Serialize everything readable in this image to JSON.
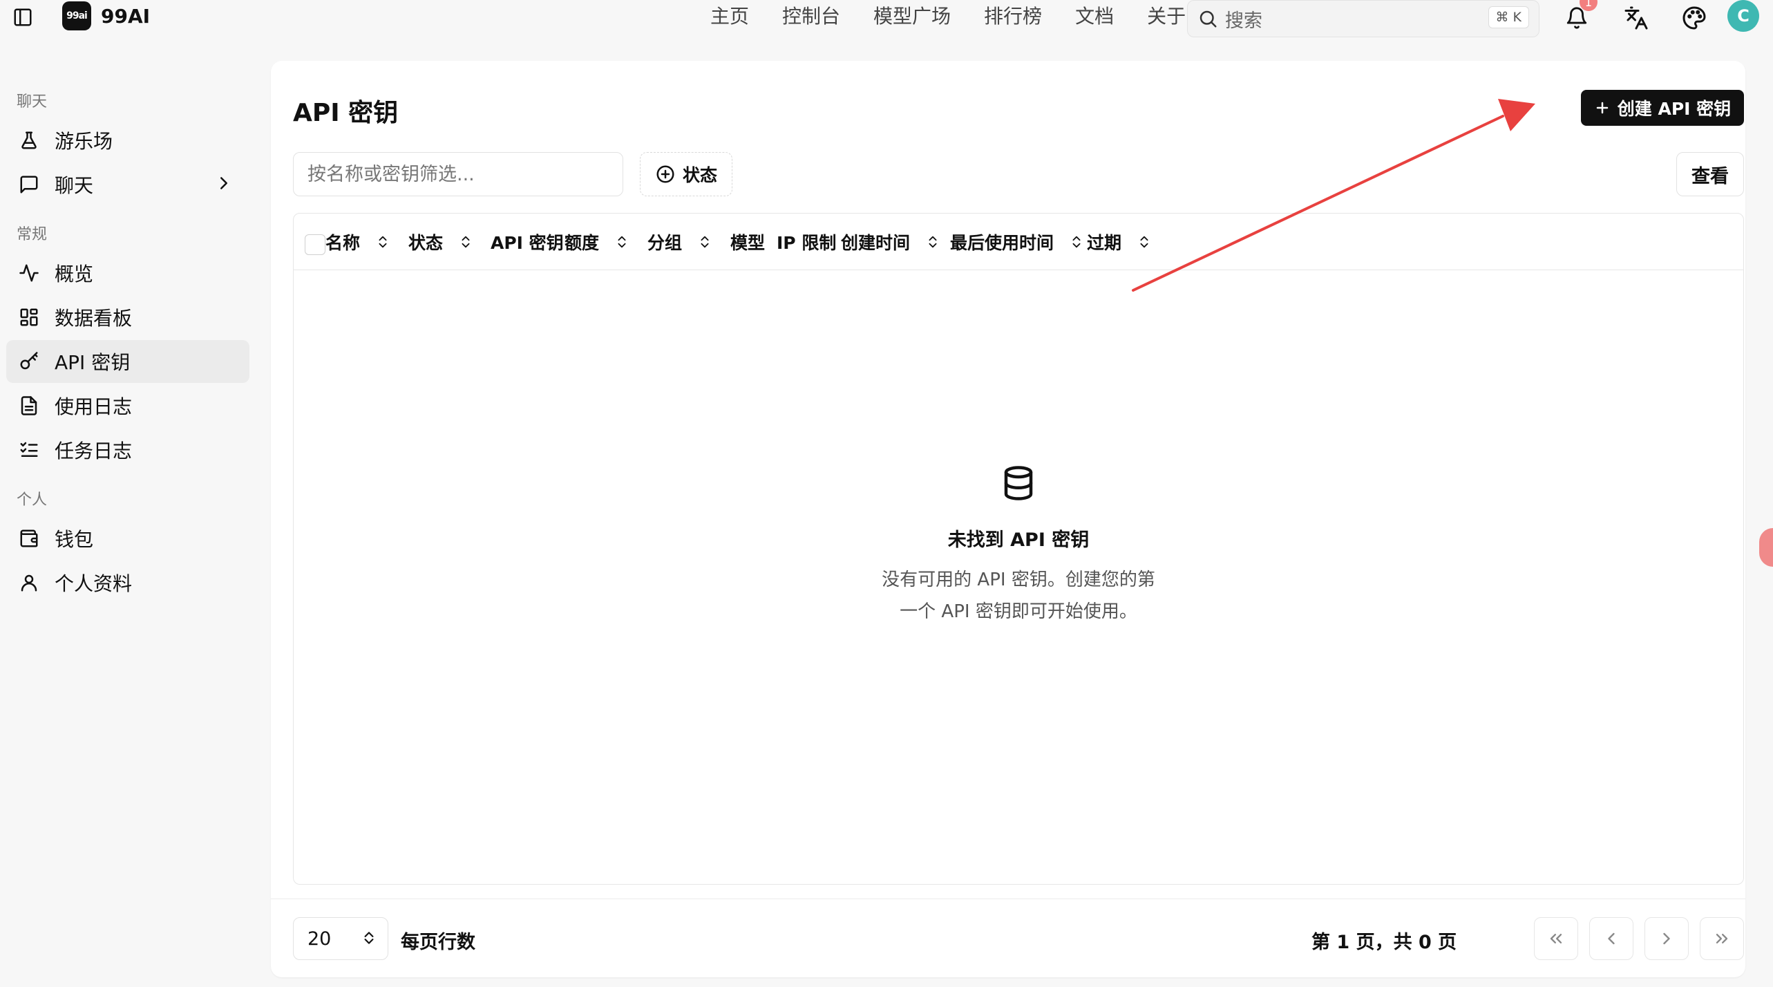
{
  "app": {
    "name": "99AI",
    "logo_text": "99ai"
  },
  "nav": [
    "主页",
    "控制台",
    "模型广场",
    "排行榜",
    "文档",
    "关于"
  ],
  "search": {
    "placeholder": "搜索",
    "shortcut": "⌘ K"
  },
  "notifications": {
    "count": "1"
  },
  "user": {
    "initial": "C"
  },
  "sidebar": {
    "groups": [
      {
        "label": "聊天",
        "items": [
          {
            "label": "游乐场",
            "icon": "flask-icon"
          },
          {
            "label": "聊天",
            "icon": "message-square-icon",
            "has_submenu": true
          }
        ]
      },
      {
        "label": "常规",
        "items": [
          {
            "label": "概览",
            "icon": "activity-icon"
          },
          {
            "label": "数据看板",
            "icon": "layout-dashboard-icon"
          },
          {
            "label": "API 密钥",
            "icon": "key-icon",
            "active": true
          },
          {
            "label": "使用日志",
            "icon": "file-text-icon"
          },
          {
            "label": "任务日志",
            "icon": "list-checks-icon"
          }
        ]
      },
      {
        "label": "个人",
        "items": [
          {
            "label": "钱包",
            "icon": "wallet-icon"
          },
          {
            "label": "个人资料",
            "icon": "user-icon"
          }
        ]
      }
    ]
  },
  "page": {
    "title": "API 密钥",
    "create_label": "创建 API 密钥",
    "filter_placeholder": "按名称或密钥筛选...",
    "status_filter_label": "状态",
    "view_label": "查看"
  },
  "table": {
    "columns": [
      {
        "label": "名称",
        "sortable": true
      },
      {
        "label": "状态",
        "sortable": true
      },
      {
        "label": "API 密钥",
        "sortable": false
      },
      {
        "label": "额度",
        "sortable": true
      },
      {
        "label": "分组",
        "sortable": true
      },
      {
        "label": "模型",
        "sortable": false
      },
      {
        "label": "IP 限制",
        "sortable": false
      },
      {
        "label": "创建时间",
        "sortable": true
      },
      {
        "label": "最后使用时间",
        "sortable": true
      },
      {
        "label": "过期",
        "sortable": true
      }
    ],
    "empty_title": "未找到 API 密钥",
    "empty_description": "没有可用的 API 密钥。创建您的第一个 API 密钥即可开始使用。"
  },
  "pagination": {
    "page_size": "20",
    "page_size_label": "每页行数",
    "page_info": "第 1 页，共 0 页"
  },
  "colors": {
    "accent": "#111111",
    "annotation_arrow": "#e8413f",
    "avatar": "#3fb8b2"
  }
}
